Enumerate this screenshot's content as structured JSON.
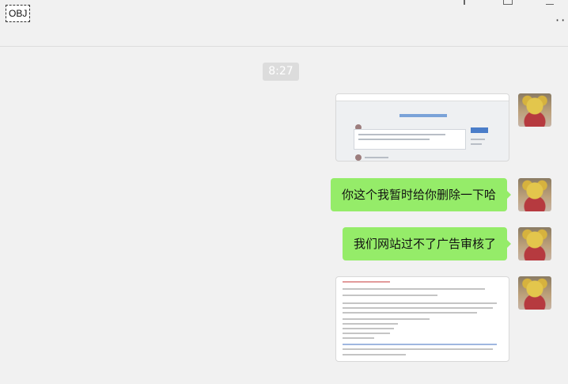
{
  "header": {
    "obj_label": "OBJ",
    "more_label": "··"
  },
  "chat": {
    "timestamp": "8:27",
    "messages": [
      {
        "type": "image",
        "description_icon": "image-thumbnail"
      },
      {
        "type": "text",
        "text": "你这个我暂时给你删除一下哈"
      },
      {
        "type": "text",
        "text": "我们网站过不了广告审核了"
      },
      {
        "type": "image",
        "description_icon": "image-thumbnail"
      }
    ]
  },
  "colors": {
    "background": "#f1f1f1",
    "bubble": "#95ec69",
    "timestamp_bg": "#dcdcdc"
  }
}
